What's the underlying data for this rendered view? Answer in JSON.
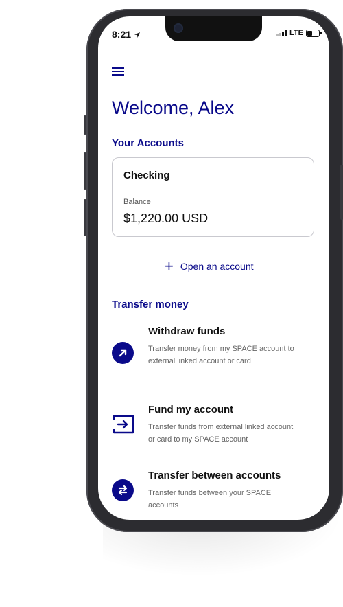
{
  "status_bar": {
    "time": "8:21",
    "network": "LTE"
  },
  "header": {
    "welcome": "Welcome, Alex"
  },
  "accounts": {
    "section_title": "Your Accounts",
    "card": {
      "name": "Checking",
      "balance_label": "Balance",
      "balance": "$1,220.00 USD"
    },
    "open_account": "Open an account"
  },
  "transfer": {
    "section_title": "Transfer money",
    "items": [
      {
        "title": "Withdraw funds",
        "desc": "Transfer money from my SPACE account to external linked account or card",
        "icon": "arrow-up-right-icon"
      },
      {
        "title": "Fund my account",
        "desc": "Transfer funds from external linked account or card to my SPACE account",
        "icon": "fund-in-icon"
      },
      {
        "title": "Transfer between accounts",
        "desc": "Transfer funds between your SPACE accounts",
        "icon": "swap-arrows-icon"
      }
    ]
  },
  "colors": {
    "brand": "#0a0a8a",
    "text": "#111111",
    "muted": "#666666",
    "border": "#c9c9cf"
  }
}
